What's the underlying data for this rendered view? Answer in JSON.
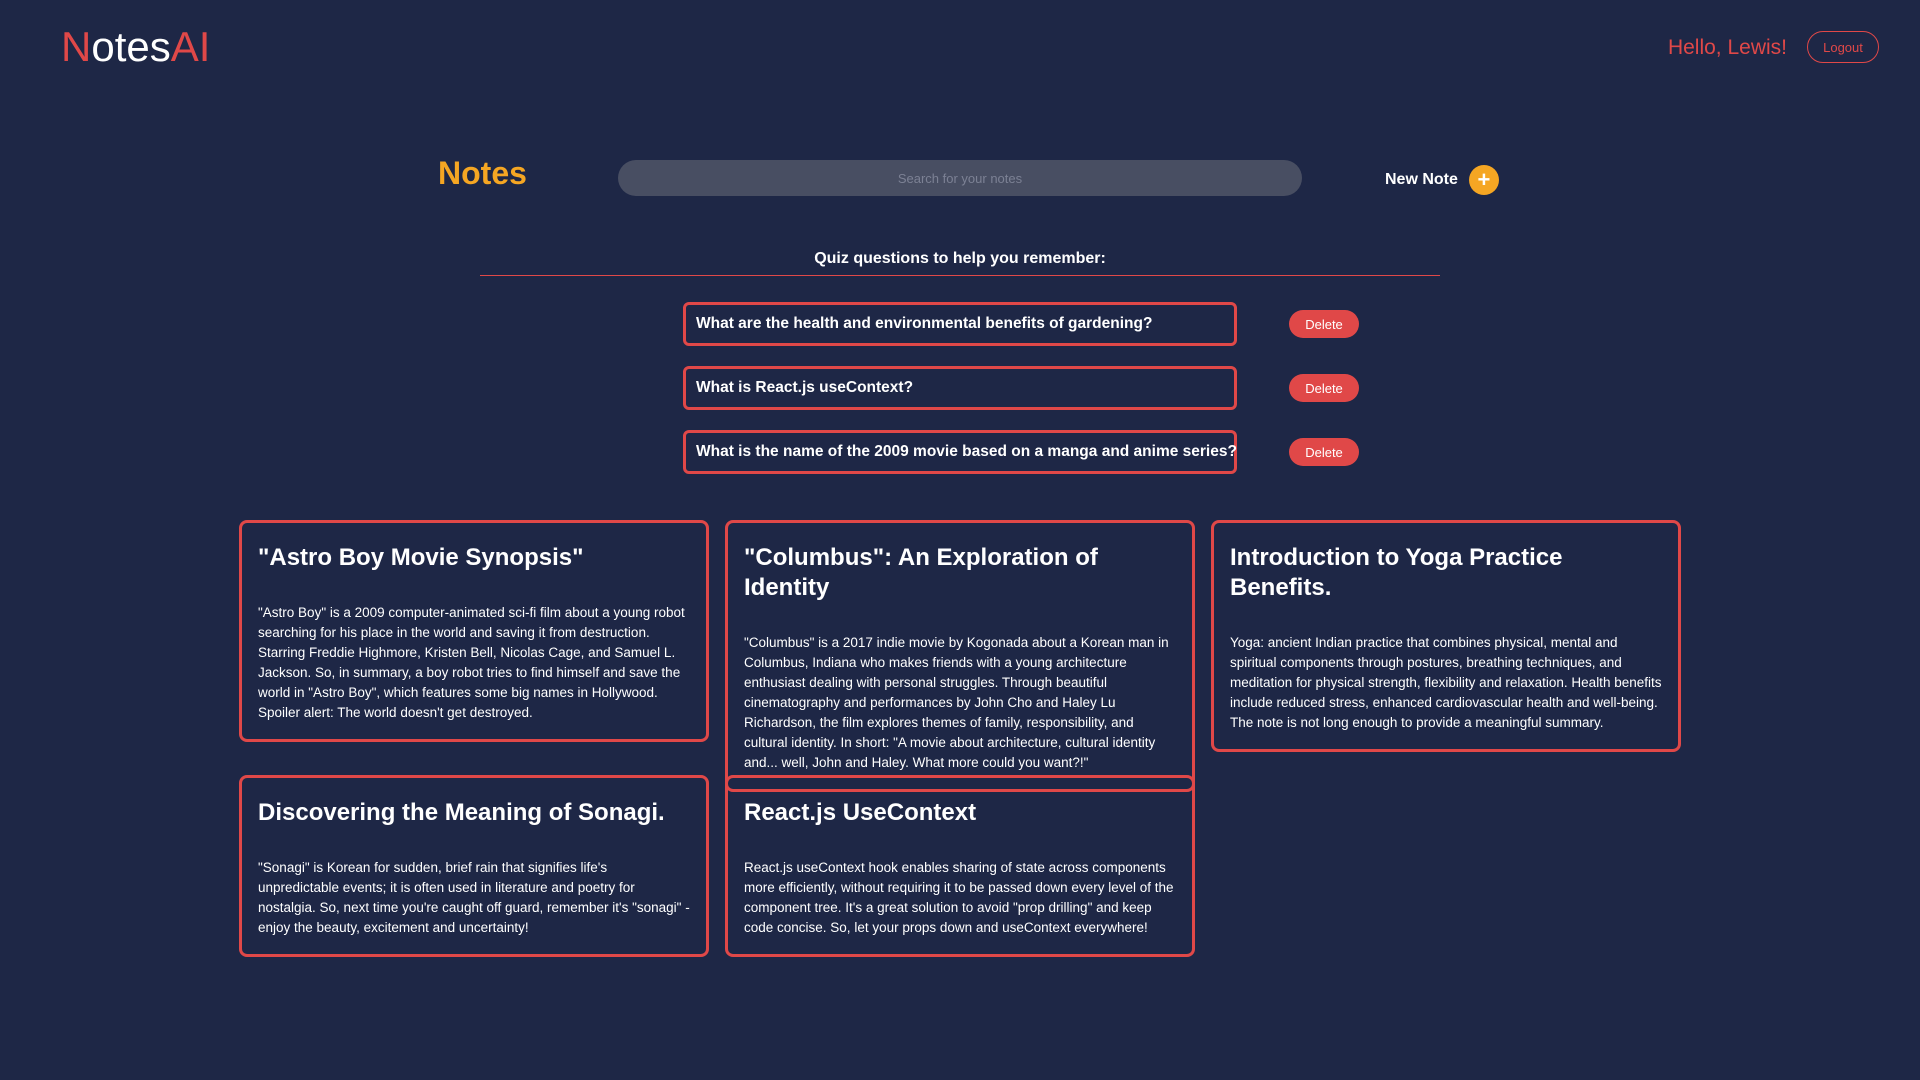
{
  "header": {
    "logo_part1": "N",
    "logo_part2": "otes",
    "logo_part3": "AI",
    "greeting": "Hello, Lewis!",
    "logout_label": "Logout"
  },
  "toolbar": {
    "heading": "Notes",
    "search_placeholder": "Search for your notes",
    "new_note_label": "New Note",
    "new_note_icon": "plus-icon"
  },
  "quiz": {
    "title": "Quiz questions to help you remember:",
    "delete_label": "Delete",
    "questions": [
      "What are the health and environmental benefits of gardening?",
      "What is React.js useContext?",
      "What is the name of the 2009 movie based on a manga and anime series?"
    ]
  },
  "notes": [
    {
      "title": "\"Astro Boy Movie Synopsis\"",
      "body": "\"Astro Boy\" is a 2009 computer-animated sci-fi film about a young robot searching for his place in the world and saving it from destruction. Starring Freddie Highmore, Kristen Bell, Nicolas Cage, and Samuel L. Jackson. So, in summary, a boy robot tries to find himself and save the world in \"Astro Boy\", which features some big names in Hollywood. Spoiler alert: The world doesn't get destroyed."
    },
    {
      "title": "\"Columbus\": An Exploration of Identity",
      "body": "\"Columbus\" is a 2017 indie movie by Kogonada about a Korean man in Columbus, Indiana who makes friends with a young architecture enthusiast dealing with personal struggles. Through beautiful cinematography and performances by John Cho and Haley Lu Richardson, the film explores themes of family, responsibility, and cultural identity. In short: \"A movie about architecture, cultural identity and... well, John and Haley. What more could you want?!\""
    },
    {
      "title": "Introduction to Yoga Practice Benefits.",
      "body": "Yoga: ancient Indian practice that combines physical, mental and spiritual components through postures, breathing techniques, and meditation for physical strength, flexibility and relaxation. Health benefits include reduced stress, enhanced cardiovascular health and well-being. The note is not long enough to provide a meaningful summary."
    },
    {
      "title": "Discovering the Meaning of Sonagi.",
      "body": "\"Sonagi\" is Korean for sudden, brief rain that signifies life's unpredictable events; it is often used in literature and poetry for nostalgia. So, next time you're caught off guard, remember it's \"sonagi\" - enjoy the beauty, excitement and uncertainty!"
    },
    {
      "title": "React.js UseContext",
      "body": "React.js useContext hook enables sharing of state across components more efficiently, without requiring it to be passed down every level of the component tree. It's a great solution to avoid \"prop drilling\" and keep code concise. So, let your props down and useContext everywhere!"
    }
  ],
  "colors": {
    "background": "#1e2746",
    "accent_red": "#e04848",
    "accent_orange": "#f5a623",
    "search_bg": "#484e62"
  }
}
